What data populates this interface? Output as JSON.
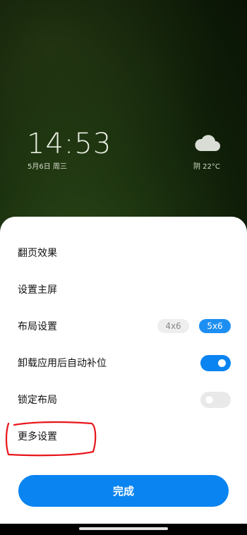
{
  "lockscreen": {
    "time": "14:53",
    "date": "5月6日 周三",
    "weather_icon": "cloud-icon",
    "weather": "阴  22°C"
  },
  "sheet": {
    "rows": [
      {
        "label": "翻页效果"
      },
      {
        "label": "设置主屏"
      },
      {
        "label": "布局设置",
        "options": [
          "4x6",
          "5x6"
        ],
        "selected": "5x6"
      },
      {
        "label": "卸载应用后自动补位",
        "toggle": true
      },
      {
        "label": "锁定布局",
        "toggle": false
      },
      {
        "label": "更多设置"
      }
    ],
    "done_label": "完成"
  },
  "colors": {
    "accent": "#0a84f0",
    "annotation": "#e8151b"
  }
}
